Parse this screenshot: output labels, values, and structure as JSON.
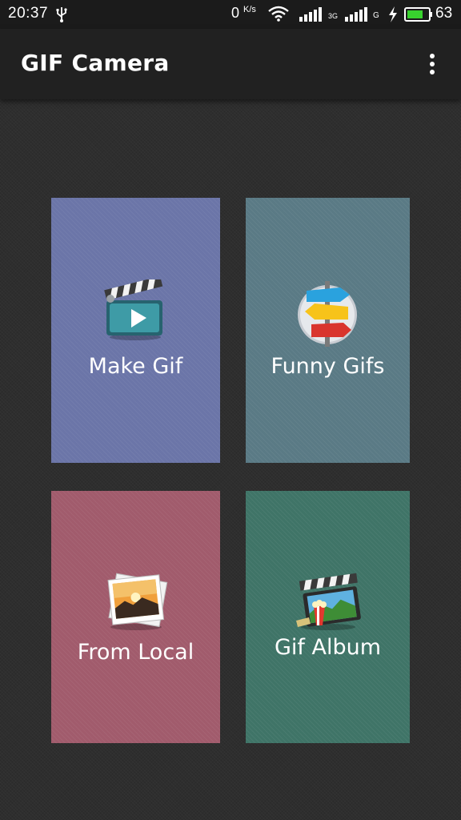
{
  "status_bar": {
    "time": "20:37",
    "net_speed": "0",
    "net_speed_unit": "K/s",
    "network_type_1": "3G",
    "network_type_2": "G",
    "battery_level": "63"
  },
  "app_bar": {
    "title": "GIF Camera",
    "menu_icon": "more-vertical-icon"
  },
  "tiles": [
    {
      "label": "Make Gif",
      "icon": "clapperboard-play-icon",
      "color": "#6b75a8"
    },
    {
      "label": "Funny Gifs",
      "icon": "signpost-icon",
      "color": "#5a7a85"
    },
    {
      "label": "From Local",
      "icon": "photos-icon",
      "color": "#a15b6c"
    },
    {
      "label": "Gif Album",
      "icon": "film-album-icon",
      "color": "#3f7467"
    }
  ],
  "colors": {
    "status_bar": "#1b1b1b",
    "app_bar": "#212121",
    "background": "#2e2e2e",
    "battery": "#38d22e"
  }
}
